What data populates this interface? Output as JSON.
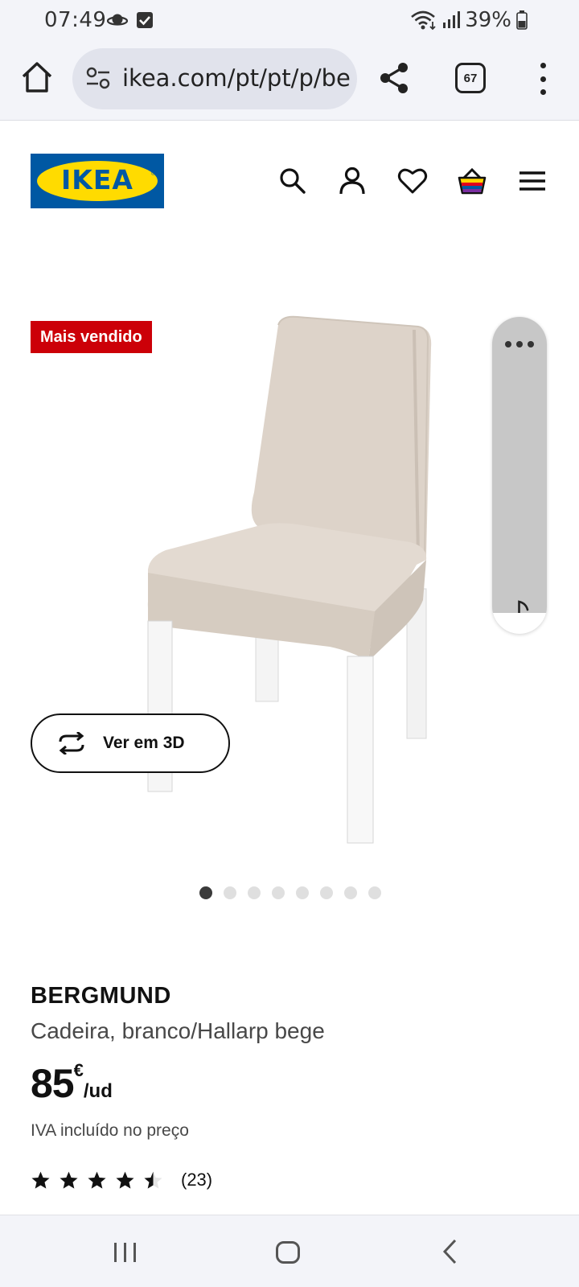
{
  "status_bar": {
    "time": "07:49",
    "battery": "39%"
  },
  "browser": {
    "url": "ikea.com/pt/pt/p/ber",
    "tab_count": "67"
  },
  "header": {
    "logo_text": "IKEA",
    "icons": [
      "search-icon",
      "account-icon",
      "wishlist-icon",
      "basket-icon",
      "hamburger-menu-icon"
    ]
  },
  "product": {
    "badge": "Mais vendido",
    "view_3d_label": "Ver em 3D",
    "carousel": {
      "count": 8,
      "active_index": 0
    },
    "name": "BERGMUND",
    "description": "Cadeira, branco/Hallarp bege",
    "price_value": "85",
    "price_currency": "€",
    "price_unit": "/ud",
    "vat_text": "IVA incluído no preço",
    "rating_value": 4.5,
    "rating_max": 5,
    "review_count": "(23)"
  },
  "colors": {
    "ikea_blue": "#0058a3",
    "ikea_yellow": "#ffdb00",
    "badge_red": "#cc0008",
    "chair_fabric": "#dcd2c8"
  }
}
